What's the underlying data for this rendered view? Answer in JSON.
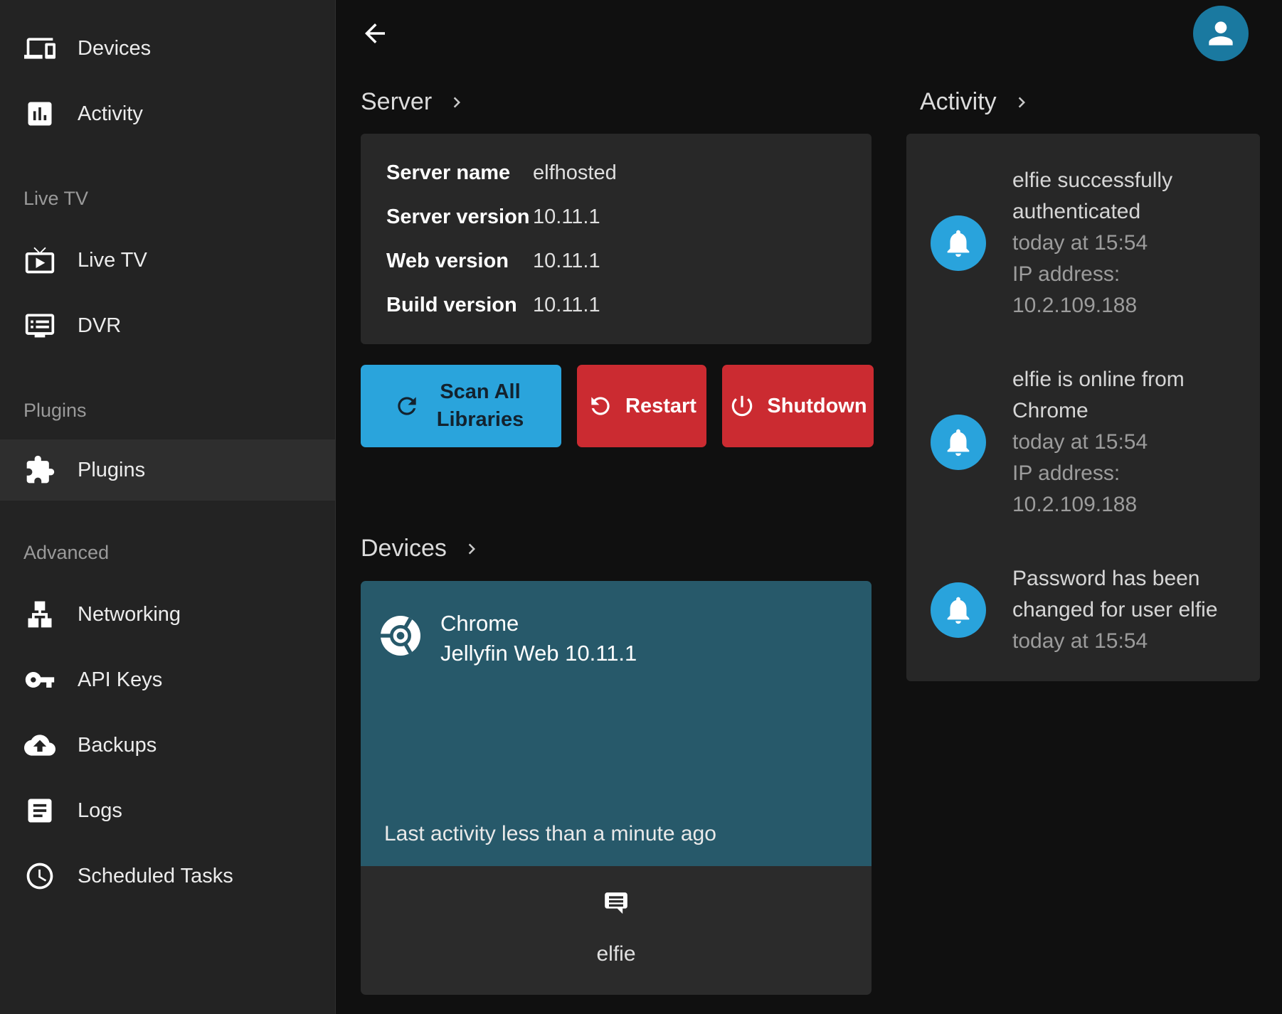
{
  "colors": {
    "accent_blue": "#2aa4dc",
    "danger_red": "#cb2b31",
    "session_teal": "#27596a",
    "avatar_blue": "#1a79a0",
    "badge_blue": "#29a3dc",
    "sidebar_bg": "#232323",
    "page_bg": "#101010",
    "card_bg": "#282828"
  },
  "topbar": {
    "back_icon": "back-arrow-icon",
    "avatar_icon": "user-avatar-icon"
  },
  "sidebar": {
    "items": [
      {
        "type": "link",
        "label": "Devices",
        "icon": "devices-icon",
        "active": false
      },
      {
        "type": "link",
        "label": "Activity",
        "icon": "activity-icon",
        "active": false
      },
      {
        "type": "header",
        "label": "Live TV"
      },
      {
        "type": "link",
        "label": "Live TV",
        "icon": "live-tv-icon",
        "active": false
      },
      {
        "type": "link",
        "label": "DVR",
        "icon": "dvr-icon",
        "active": false
      },
      {
        "type": "header",
        "label": "Plugins"
      },
      {
        "type": "link",
        "label": "Plugins",
        "icon": "plugins-icon",
        "active": true
      },
      {
        "type": "header",
        "label": "Advanced"
      },
      {
        "type": "link",
        "label": "Networking",
        "icon": "networking-icon",
        "active": false
      },
      {
        "type": "link",
        "label": "API Keys",
        "icon": "api-keys-icon",
        "active": false
      },
      {
        "type": "link",
        "label": "Backups",
        "icon": "backups-icon",
        "active": false
      },
      {
        "type": "link",
        "label": "Logs",
        "icon": "logs-icon",
        "active": false
      },
      {
        "type": "link",
        "label": "Scheduled Tasks",
        "icon": "scheduled-tasks-icon",
        "active": false
      }
    ]
  },
  "server_section": {
    "title": "Server",
    "rows": [
      {
        "label": "Server name",
        "value": "elfhosted"
      },
      {
        "label": "Server version",
        "value": "10.11.1"
      },
      {
        "label": "Web version",
        "value": "10.11.1"
      },
      {
        "label": "Build version",
        "value": "10.11.1"
      }
    ],
    "buttons": {
      "scan": "Scan All Libraries",
      "restart": "Restart",
      "shutdown": "Shutdown"
    }
  },
  "devices_section": {
    "title": "Devices",
    "device": {
      "name": "Chrome",
      "client": "Jellyfin Web 10.11.1",
      "last_activity": "Last activity less than a minute ago",
      "user": "elfie",
      "icon": "chrome-icon",
      "user_icon": "message-icon"
    }
  },
  "activity_section": {
    "title": "Activity",
    "items": [
      {
        "icon": "bell-icon",
        "message": "elfie successfully authenticated",
        "date": "today at 15:54",
        "ip": "IP address: 10.2.109.188"
      },
      {
        "icon": "bell-icon",
        "message": "elfie is online from Chrome",
        "date": "today at 15:54",
        "ip": "IP address: 10.2.109.188"
      },
      {
        "icon": "bell-icon",
        "message": "Password has been changed for user elfie",
        "date": "today at 15:54",
        "ip": ""
      }
    ]
  }
}
